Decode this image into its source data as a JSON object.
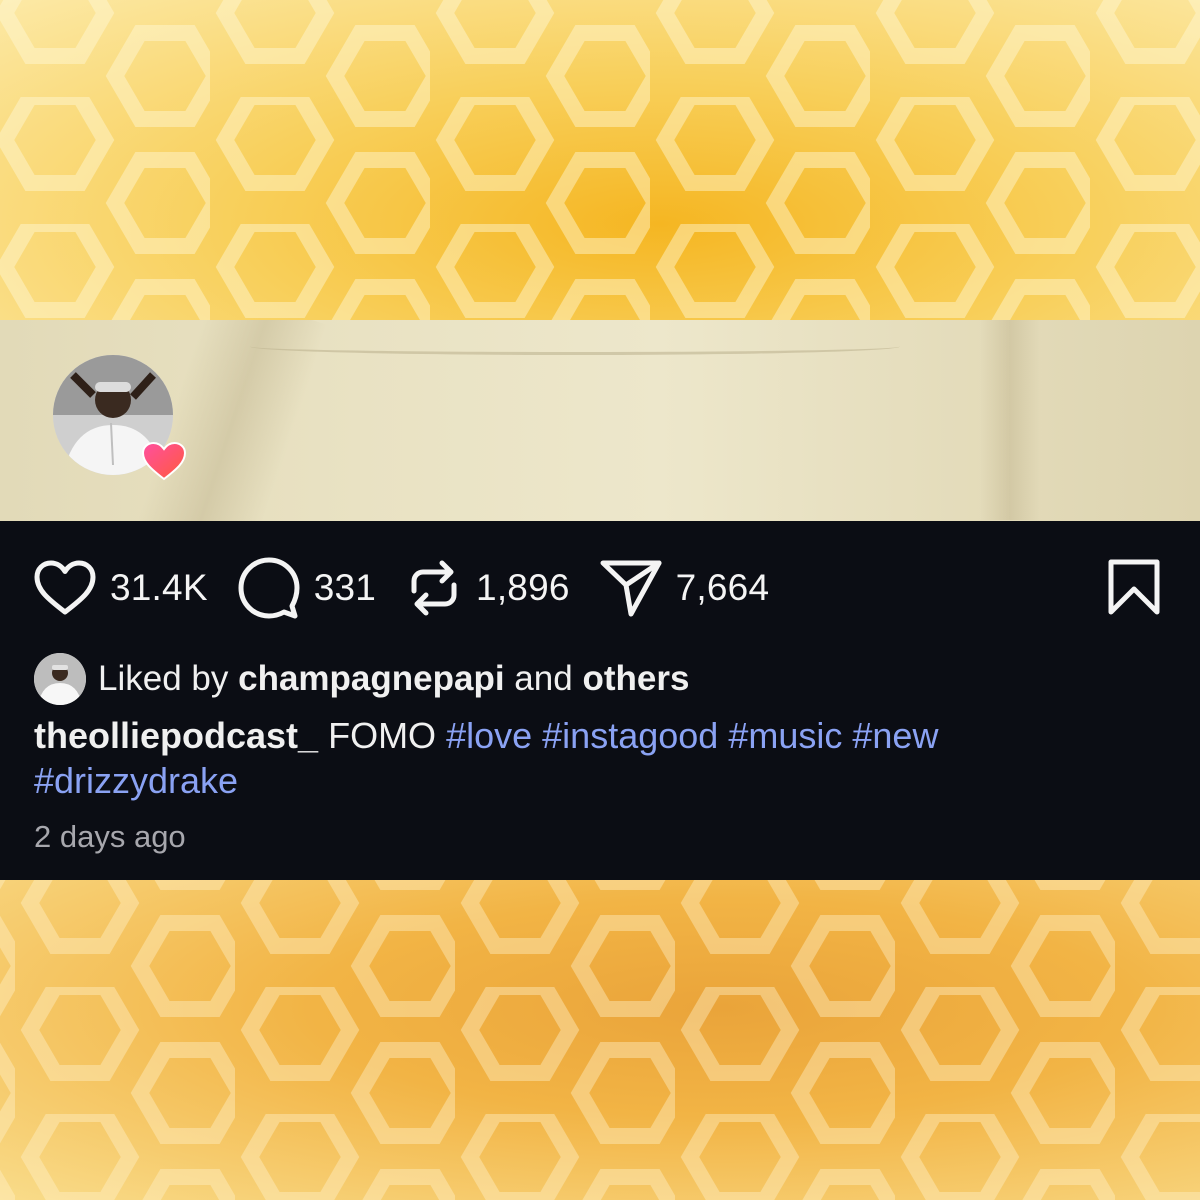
{
  "post": {
    "likes": "31.4K",
    "comments": "331",
    "reposts": "1,896",
    "shares": "7,664",
    "liked_by": {
      "prefix": "Liked by",
      "user": "champagnepapi",
      "middle": "and",
      "others": "others"
    },
    "caption": {
      "username": "theolliepodcast_",
      "text": "FOMO",
      "hashtags": [
        "#love",
        "#instagood",
        "#music",
        "#new",
        "#drizzydrake"
      ]
    },
    "timestamp": "2 days ago"
  },
  "icons": {
    "like": "heart-icon",
    "comment": "comment-bubble-icon",
    "repost": "repost-icon",
    "share": "paper-plane-icon",
    "save": "bookmark-icon",
    "badge": "pink-heart-badge-icon"
  },
  "colors": {
    "panel_background": "#0b0d14",
    "text": "#f4f4f4",
    "hashtag": "#8aa2f3",
    "timestamp": "#a7a7ad",
    "honey_dark": "#f5b622",
    "honey_light": "#fce9a6"
  }
}
